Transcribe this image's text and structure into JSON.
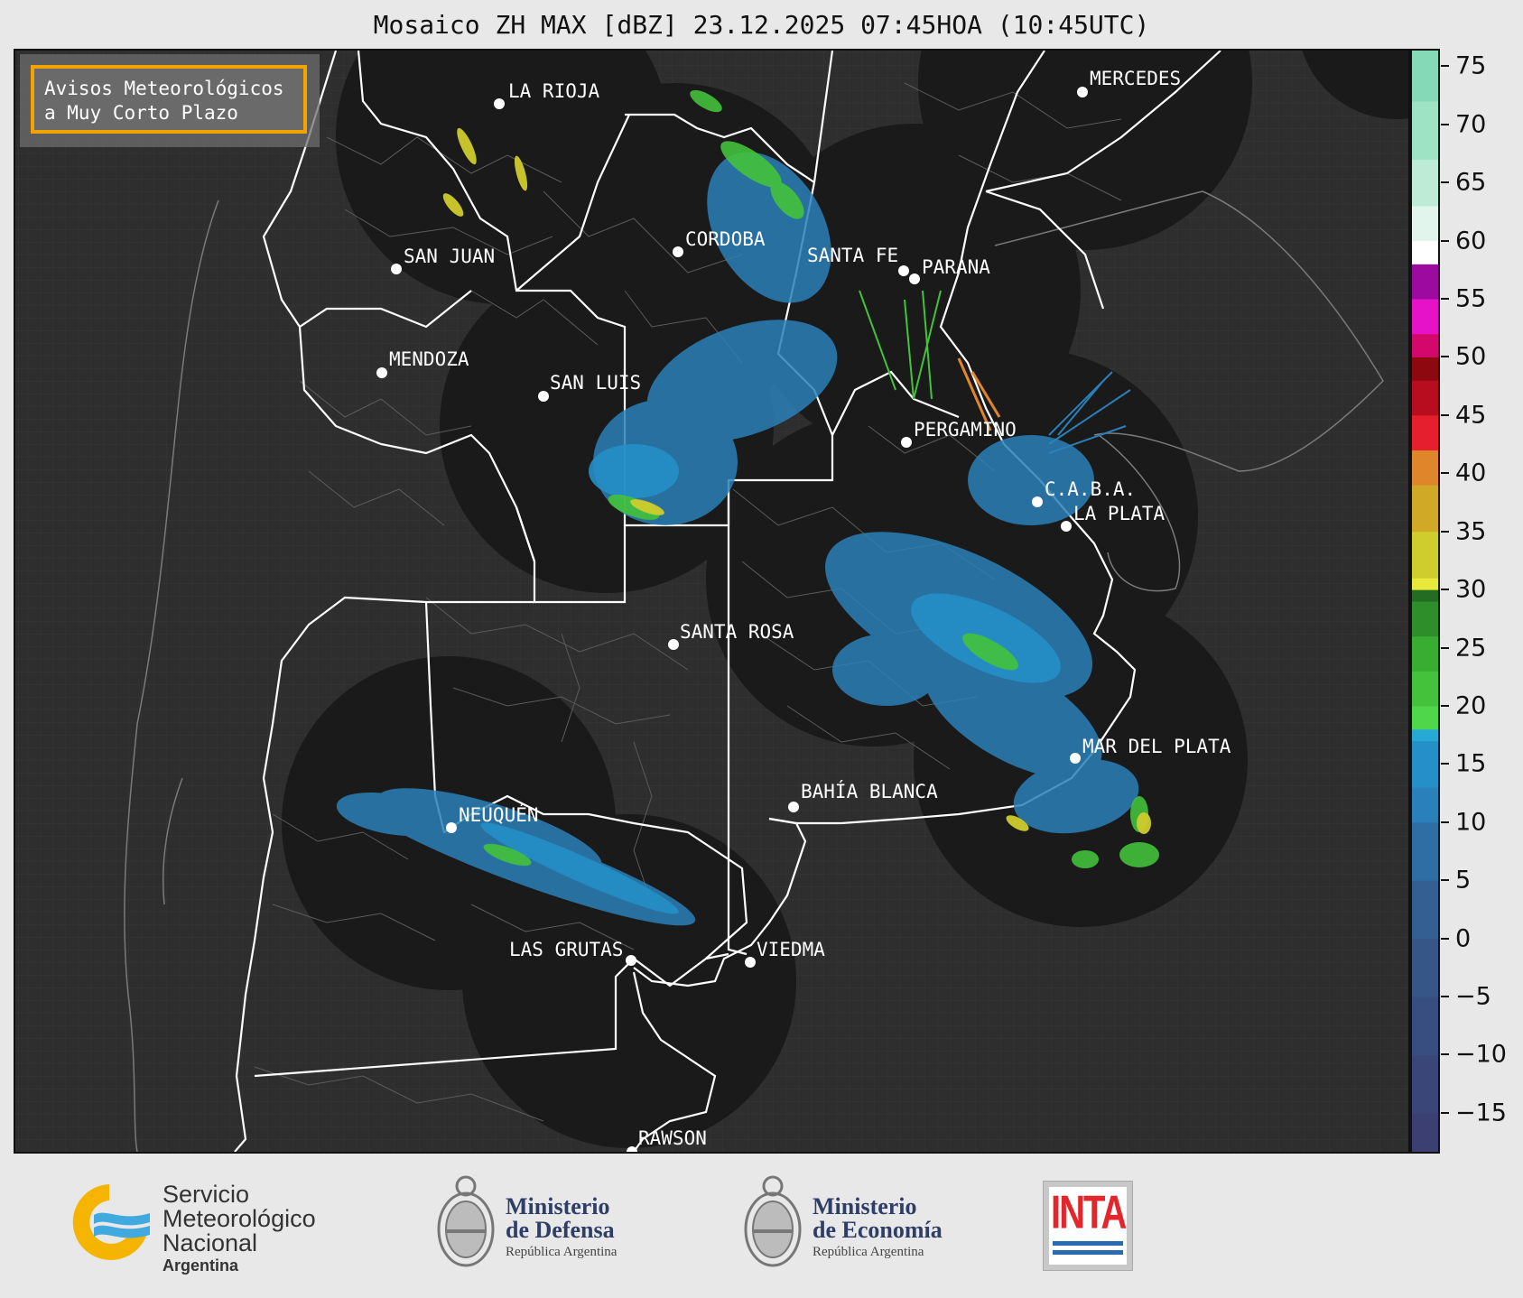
{
  "title": "Mosaico ZH MAX [dBZ] 23.12.2025 07:45HOA (10:45UTC)",
  "badge": {
    "line1": "Avisos Meteorológicos",
    "line2": "a Muy Corto Plazo",
    "border_color": "#f3a300"
  },
  "colors": {
    "background": "#2e2e2e",
    "radar_disc": "#1a1a1a",
    "boundary": "#ffffff",
    "internal": "#5a5a5a"
  },
  "cities": [
    {
      "name": "LA RIOJA"
    },
    {
      "name": "MERCEDES"
    },
    {
      "name": "SAN JUAN"
    },
    {
      "name": "CORDOBA"
    },
    {
      "name": "SANTA FE"
    },
    {
      "name": "PARANA"
    },
    {
      "name": "MENDOZA"
    },
    {
      "name": "SAN LUIS"
    },
    {
      "name": "PERGAMINO"
    },
    {
      "name": "C.A.B.A."
    },
    {
      "name": "LA PLATA"
    },
    {
      "name": "SANTA ROSA"
    },
    {
      "name": "MAR DEL PLATA"
    },
    {
      "name": "BAHÍA BLANCA"
    },
    {
      "name": "NEUQUÉN"
    },
    {
      "name": "LAS GRUTAS"
    },
    {
      "name": "VIEDMA"
    },
    {
      "name": "RAWSON"
    }
  ],
  "colorbar": {
    "min": -18.5,
    "max": 76.5,
    "ticks": [
      75,
      70,
      65,
      60,
      55,
      50,
      45,
      40,
      35,
      30,
      25,
      20,
      15,
      10,
      5,
      0,
      -5,
      -10,
      -15
    ],
    "tick_labels": [
      "75",
      "70",
      "65",
      "60",
      "55",
      "50",
      "45",
      "40",
      "35",
      "30",
      "25",
      "20",
      "15",
      "10",
      "5",
      "0",
      "−5",
      "−10",
      "−15"
    ],
    "stops": [
      {
        "from": -18.5,
        "to": -15,
        "color": "#3b3f72"
      },
      {
        "from": -15,
        "to": -10,
        "color": "#3a4578"
      },
      {
        "from": -10,
        "to": -5,
        "color": "#384d80"
      },
      {
        "from": -5,
        "to": 0,
        "color": "#365688"
      },
      {
        "from": 0,
        "to": 5,
        "color": "#335f92"
      },
      {
        "from": 5,
        "to": 10,
        "color": "#2f6ea2"
      },
      {
        "from": 10,
        "to": 13,
        "color": "#2a80b8"
      },
      {
        "from": 13,
        "to": 17,
        "color": "#2590c8"
      },
      {
        "from": 17,
        "to": 18,
        "color": "#27a9d6"
      },
      {
        "from": 18,
        "to": 20,
        "color": "#4fd64a"
      },
      {
        "from": 20,
        "to": 23,
        "color": "#44c23c"
      },
      {
        "from": 23,
        "to": 26,
        "color": "#38ad32"
      },
      {
        "from": 26,
        "to": 29,
        "color": "#2e8e2a"
      },
      {
        "from": 29,
        "to": 30,
        "color": "#236d22"
      },
      {
        "from": 30,
        "to": 31,
        "color": "#e8e83a"
      },
      {
        "from": 31,
        "to": 35,
        "color": "#cfcc2e"
      },
      {
        "from": 35,
        "to": 39,
        "color": "#d0a926"
      },
      {
        "from": 39,
        "to": 42,
        "color": "#e0862a"
      },
      {
        "from": 42,
        "to": 45,
        "color": "#e61f2e"
      },
      {
        "from": 45,
        "to": 48,
        "color": "#b70d1e"
      },
      {
        "from": 48,
        "to": 50,
        "color": "#8e0810"
      },
      {
        "from": 50,
        "to": 52,
        "color": "#d4086c"
      },
      {
        "from": 52,
        "to": 55,
        "color": "#e612c8"
      },
      {
        "from": 55,
        "to": 58,
        "color": "#9c0aa0"
      },
      {
        "from": 58,
        "to": 60,
        "color": "#ffffff"
      },
      {
        "from": 60,
        "to": 63,
        "color": "#e2f5ec"
      },
      {
        "from": 63,
        "to": 67,
        "color": "#bdebd5"
      },
      {
        "from": 67,
        "to": 72,
        "color": "#9ee3c4"
      },
      {
        "from": 72,
        "to": 76.5,
        "color": "#86d9b6"
      }
    ]
  },
  "logos": {
    "smn": {
      "line1": "Servicio",
      "line2": "Meteorológico",
      "line3": "Nacional",
      "line4": "Argentina"
    },
    "defensa": {
      "line1": "Ministerio",
      "line2": "de Defensa",
      "line3": "República Argentina"
    },
    "economia": {
      "line1": "Ministerio",
      "line2": "de Economía",
      "line3": "República Argentina"
    },
    "inta": {
      "word": "INTA"
    }
  }
}
